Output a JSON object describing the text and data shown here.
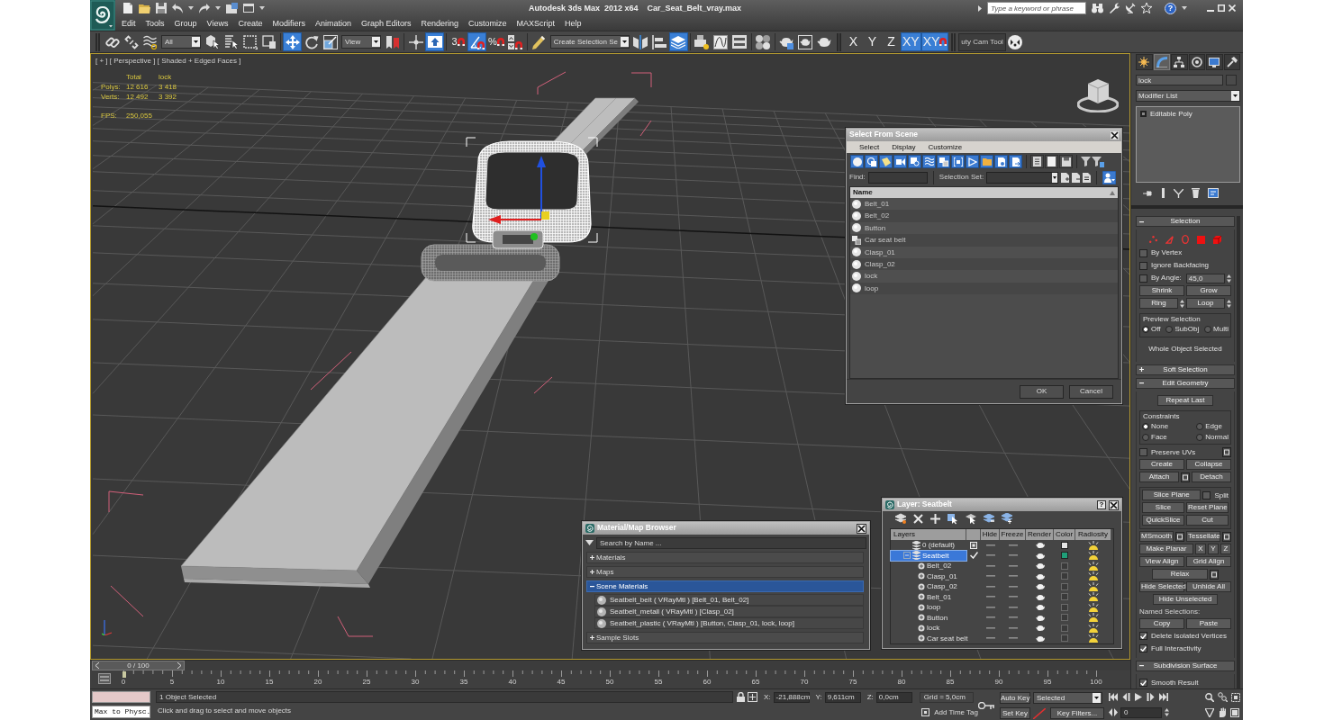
{
  "window": {
    "title": "Autodesk 3ds Max  2012 x64",
    "file": "Car_Seat_Belt_vray.max",
    "search": {
      "placeholder": "Type a keyword or phrase"
    },
    "help": "?"
  },
  "menu": [
    "Edit",
    "Tools",
    "Group",
    "Views",
    "Create",
    "Modifiers",
    "Animation",
    "Graph Editors",
    "Rendering",
    "Customize",
    "MAXScript",
    "Help"
  ],
  "toolbar": [
    {
      "kind": "tool",
      "active": false
    },
    {
      "kind": "tool",
      "active": false
    },
    {
      "kind": "tool",
      "active": false
    },
    {
      "kind": "dropdown",
      "value": "All"
    },
    {
      "kind": "tool",
      "active": false
    },
    {
      "kind": "tool",
      "active": false
    },
    {
      "kind": "tool",
      "active": false
    },
    {
      "kind": "tool",
      "active": false
    },
    {
      "kind": "separator"
    },
    {
      "kind": "tool",
      "active": true
    },
    {
      "kind": "tool",
      "active": false
    },
    {
      "kind": "tool",
      "active": false
    },
    {
      "kind": "dropdown",
      "value": "View"
    },
    {
      "kind": "tool",
      "active": false
    },
    {
      "kind": "separator"
    },
    {
      "kind": "tool",
      "active": false
    },
    {
      "kind": "tool",
      "active": true
    },
    {
      "kind": "separator"
    },
    {
      "kind": "tool",
      "label": "3",
      "active": false
    },
    {
      "kind": "tool",
      "active": true
    },
    {
      "kind": "tool",
      "label": "%",
      "active": false
    },
    {
      "kind": "tool",
      "active": false
    },
    {
      "kind": "separator"
    },
    {
      "kind": "tool",
      "active": false
    },
    {
      "kind": "dropdown",
      "value": "Create Selection Se"
    },
    {
      "kind": "tool",
      "active": false
    },
    {
      "kind": "tool",
      "active": false
    },
    {
      "kind": "tool",
      "active": true
    },
    {
      "kind": "separator"
    },
    {
      "kind": "tool",
      "active": false
    },
    {
      "kind": "tool",
      "active": false
    },
    {
      "kind": "tool",
      "active": false
    },
    {
      "kind": "separator"
    },
    {
      "kind": "tool",
      "active": false
    },
    {
      "kind": "separator"
    },
    {
      "kind": "tool",
      "active": false
    },
    {
      "kind": "tool",
      "active": false
    },
    {
      "kind": "tool",
      "active": false
    },
    {
      "kind": "grip"
    },
    {
      "kind": "axis",
      "label": "X",
      "active": false
    },
    {
      "kind": "axis",
      "label": "Y",
      "active": false
    },
    {
      "kind": "axis",
      "label": "Z",
      "active": false
    },
    {
      "kind": "axis",
      "label": "XY",
      "active": true
    },
    {
      "kind": "axis_snap",
      "label": "XY",
      "active": true
    },
    {
      "kind": "grip"
    },
    {
      "kind": "tab",
      "label": "uty Cam Tool"
    },
    {
      "kind": "tool",
      "active": false
    }
  ],
  "viewport": {
    "label": "[ + ] [ Perspective ] [ Shaded + Edged Faces ]",
    "stats": {
      "columns": [
        "Total",
        "lock"
      ],
      "rows": [
        {
          "label": "Polys:",
          "values": [
            "12 616",
            "3 418"
          ]
        },
        {
          "label": "Verts:",
          "values": [
            "12 492",
            "3 392"
          ]
        }
      ],
      "fps": {
        "label": "FPS:",
        "value": "250,055"
      }
    }
  },
  "select_from_scene": {
    "title": "Select From Scene",
    "menu": [
      "Select",
      "Display",
      "Customize"
    ],
    "filters": [
      {
        "active": true
      },
      {
        "active": true
      },
      {
        "active": true
      },
      {
        "active": true
      },
      {
        "active": true
      },
      {
        "active": true
      },
      {
        "active": true
      },
      {
        "active": true
      },
      {
        "active": true
      },
      {
        "active": true
      },
      {
        "active": true
      },
      {
        "active": true
      },
      {
        "active": false
      },
      {
        "active": false
      },
      {
        "active": false
      }
    ],
    "find_label": "Find:",
    "selection_set_label": "Selection Set:",
    "column": "Name",
    "objects": [
      {
        "name": "Belt_01",
        "kind": "geometry"
      },
      {
        "name": "Belt_02",
        "kind": "geometry"
      },
      {
        "name": "Button",
        "kind": "geometry"
      },
      {
        "name": "Car seat belt",
        "kind": "group"
      },
      {
        "name": "Clasp_01",
        "kind": "geometry"
      },
      {
        "name": "Clasp_02",
        "kind": "geometry"
      },
      {
        "name": "lock",
        "kind": "geometry"
      },
      {
        "name": "loop",
        "kind": "geometry"
      }
    ],
    "buttons": [
      "OK",
      "Cancel"
    ]
  },
  "material_browser": {
    "title": "Material/Map Browser",
    "search": {
      "placeholder": "Search by Name ..."
    },
    "groups": [
      {
        "label": "Materials",
        "expanded": false,
        "selected": false
      },
      {
        "label": "Maps",
        "expanded": false,
        "selected": false
      },
      {
        "label": "Scene Materials",
        "expanded": true,
        "selected": true,
        "items": [
          "Seatbelt_belt ( VRayMtl ) [Belt_01, Belt_02]",
          "Seatbelt_metall ( VRayMtl ) [Clasp_02]",
          "Seatbelt_plastic ( VRayMtl ) [Button, Clasp_01, lock, loop]"
        ]
      },
      {
        "label": "Sample Slots",
        "expanded": false,
        "selected": false
      }
    ]
  },
  "layer_manager": {
    "title": "Layer: Seatbelt",
    "help": "?",
    "columns": [
      "Layers",
      "",
      "Hide",
      "Freeze",
      "Render",
      "Color",
      "Radiosity"
    ],
    "layers": [
      {
        "name": "0 (default)",
        "current": false,
        "selected": false,
        "color": "#e6e6e6"
      },
      {
        "name": "Seatbelt",
        "current": true,
        "selected": true,
        "expanded": true,
        "color": "#1f9e78",
        "children": [
          {
            "name": "Belt_02"
          },
          {
            "name": "Clasp_01"
          },
          {
            "name": "Clasp_02"
          },
          {
            "name": "Belt_01"
          },
          {
            "name": "loop"
          },
          {
            "name": "Button"
          },
          {
            "name": "lock"
          },
          {
            "name": "Car seat belt"
          }
        ]
      }
    ]
  },
  "command_panel": {
    "tabs": [
      {
        "selected": false
      },
      {
        "selected": true
      },
      {
        "selected": false
      },
      {
        "selected": false
      },
      {
        "selected": false
      },
      {
        "selected": false
      }
    ],
    "object_name": "lock",
    "modifier_list": "Modifier List",
    "stack": [
      {
        "name": "Editable Poly"
      }
    ],
    "rollouts": [
      {
        "title": "Selection",
        "expanded": true,
        "controls": [
          {
            "kind": "subobject"
          },
          {
            "kind": "row",
            "items": [
              {
                "kind": "checkbox",
                "label": "By Vertex",
                "checked": false
              }
            ]
          },
          {
            "kind": "row",
            "items": [
              {
                "kind": "checkbox",
                "label": "Ignore Backfacing",
                "checked": false
              }
            ]
          },
          {
            "kind": "row",
            "items": [
              {
                "kind": "checkbox",
                "label": "By Angle:",
                "checked": false,
                "value": "45,0"
              }
            ]
          },
          {
            "kind": "row",
            "items": [
              {
                "kind": "button",
                "label": "Shrink"
              },
              {
                "kind": "button",
                "label": "Grow"
              }
            ]
          },
          {
            "kind": "row",
            "items": [
              {
                "kind": "button",
                "label": "Ring",
                "spinner": true
              },
              {
                "kind": "button",
                "label": "Loop",
                "spinner": true
              }
            ]
          },
          {
            "kind": "group",
            "label": "Preview Selection",
            "controls": [
              {
                "kind": "radios",
                "options": [
                  {
                    "label": "Off",
                    "selected": true
                  },
                  {
                    "label": "SubObj",
                    "selected": false
                  },
                  {
                    "label": "Multi",
                    "selected": false
                  }
                ]
              }
            ]
          },
          {
            "kind": "note",
            "text": "Whole Object Selected"
          }
        ]
      },
      {
        "title": "Soft Selection",
        "expanded": false
      },
      {
        "title": "Edit Geometry",
        "expanded": true,
        "controls": [
          {
            "kind": "row",
            "items": [
              {
                "kind": "button",
                "label": "Repeat Last"
              }
            ]
          },
          {
            "kind": "group",
            "label": "Constraints",
            "controls": [
              {
                "kind": "radios",
                "options": [
                  {
                    "label": "None",
                    "selected": true
                  },
                  {
                    "label": "Edge",
                    "selected": false
                  },
                  {
                    "label": "Face",
                    "selected": false
                  },
                  {
                    "label": "Normal",
                    "selected": false
                  }
                ]
              }
            ]
          },
          {
            "kind": "row",
            "items": [
              {
                "kind": "checkbox",
                "label": "Preserve UVs",
                "checked": false,
                "settings": true
              }
            ]
          },
          {
            "kind": "row",
            "items": [
              {
                "kind": "button",
                "label": "Create"
              },
              {
                "kind": "button",
                "label": "Collapse"
              }
            ]
          },
          {
            "kind": "row",
            "items": [
              {
                "kind": "button",
                "label": "Attach",
                "settings": true
              },
              {
                "kind": "button",
                "label": "Detach"
              }
            ]
          },
          {
            "kind": "group",
            "controls": [
              {
                "kind": "row",
                "items": [
                  {
                    "kind": "button",
                    "label": "Slice Plane"
                  },
                  {
                    "kind": "checkbox",
                    "label": "Split",
                    "checked": false
                  }
                ]
              },
              {
                "kind": "row",
                "items": [
                  {
                    "kind": "button",
                    "label": "Slice"
                  },
                  {
                    "kind": "button",
                    "label": "Reset Plane"
                  }
                ]
              },
              {
                "kind": "row",
                "items": [
                  {
                    "kind": "button",
                    "label": "QuickSlice"
                  },
                  {
                    "kind": "button",
                    "label": "Cut"
                  }
                ]
              }
            ]
          },
          {
            "kind": "row",
            "items": [
              {
                "kind": "button",
                "label": "MSmooth",
                "settings": true
              },
              {
                "kind": "button",
                "label": "Tessellate",
                "settings": true
              }
            ]
          },
          {
            "kind": "row",
            "items": [
              {
                "kind": "button",
                "label": "Make Planar"
              },
              {
                "kind": "small_button",
                "label": "X"
              },
              {
                "kind": "small_button",
                "label": "Y"
              },
              {
                "kind": "small_button",
                "label": "Z"
              }
            ]
          },
          {
            "kind": "row",
            "items": [
              {
                "kind": "button",
                "label": "View Align"
              },
              {
                "kind": "button",
                "label": "Grid Align"
              }
            ]
          },
          {
            "kind": "row",
            "items": [
              {
                "kind": "button",
                "label": "Relax",
                "settings": true
              }
            ]
          },
          {
            "kind": "row",
            "items": [
              {
                "kind": "button",
                "label": "Hide Selected"
              },
              {
                "kind": "button",
                "label": "Unhide All"
              }
            ]
          },
          {
            "kind": "row",
            "items": [
              {
                "kind": "button",
                "label": "Hide Unselected"
              }
            ]
          },
          {
            "kind": "label",
            "text": "Named Selections:"
          },
          {
            "kind": "row",
            "items": [
              {
                "kind": "button",
                "label": "Copy"
              },
              {
                "kind": "button",
                "label": "Paste"
              }
            ]
          },
          {
            "kind": "row",
            "items": [
              {
                "kind": "checkbox",
                "label": "Delete Isolated Vertices",
                "checked": true
              }
            ]
          },
          {
            "kind": "row",
            "items": [
              {
                "kind": "checkbox",
                "label": "Full Interactivity",
                "checked": true
              }
            ]
          }
        ]
      },
      {
        "title": "Subdivision Surface",
        "expanded": true,
        "controls": [
          {
            "kind": "row",
            "items": [
              {
                "kind": "checkbox",
                "label": "Smooth Result",
                "checked": true
              }
            ]
          }
        ]
      }
    ]
  },
  "time_slider": {
    "label": "0 / 100",
    "level": 0
  },
  "track_bar": {
    "ticks": [
      "0",
      "5",
      "10",
      "15",
      "20",
      "25",
      "30",
      "35",
      "40",
      "45",
      "50",
      "55",
      "60",
      "65",
      "70",
      "75",
      "80",
      "85",
      "90",
      "95",
      "100"
    ]
  },
  "status_bar": {
    "listener_output": "Max to Physc.",
    "selection": "1 Object Selected",
    "prompt": "Click and drag to select and move objects",
    "coords": [
      {
        "axis": "X:",
        "value": "-21,888cm"
      },
      {
        "axis": "Y:",
        "value": "9,611cm"
      },
      {
        "axis": "Z:",
        "value": "0,0cm"
      }
    ],
    "grid": "Grid = 5,0cm",
    "time_tag": "Add Time Tag",
    "auto_key": "Auto Key",
    "key_mode": "Selected",
    "set_key": "Set Key",
    "key_filters": "Key Filters...",
    "frame": "0"
  }
}
